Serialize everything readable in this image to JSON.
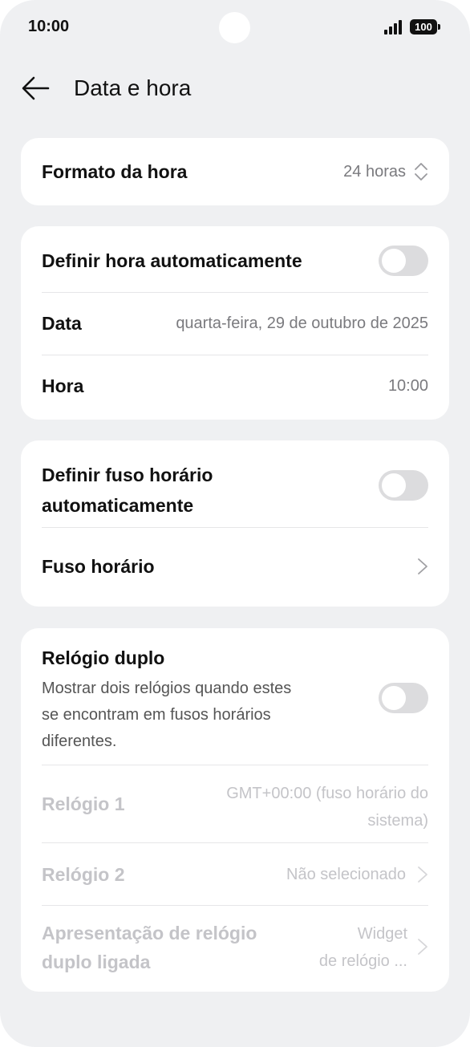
{
  "status_bar": {
    "time": "10:00",
    "battery": "100"
  },
  "header": {
    "title": "Data e hora"
  },
  "time_format": {
    "label": "Formato da hora",
    "value": "24 horas"
  },
  "auto_time": {
    "label": "Definir hora automaticamente",
    "enabled": false
  },
  "date": {
    "label": "Data",
    "value": "quarta-feira, 29 de outubro de 2025"
  },
  "time": {
    "label": "Hora",
    "value": "10:00"
  },
  "auto_timezone": {
    "label_line1": "Definir fuso horário",
    "label_line2": "automaticamente",
    "enabled": false
  },
  "timezone": {
    "label": "Fuso horário"
  },
  "dual_clock": {
    "label": "Relógio duplo",
    "desc_line1": "Mostrar dois relógios quando estes",
    "desc_line2": "se encontram em fusos horários",
    "desc_line3": "diferentes.",
    "enabled": false
  },
  "clock1": {
    "label": "Relógio 1",
    "value_line1": "GMT+00:00 (fuso horário do",
    "value_line2": "sistema)"
  },
  "clock2": {
    "label": "Relógio 2",
    "value": "Não selecionado"
  },
  "dual_display": {
    "label_line1": "Apresentação de relógio",
    "label_line2": "duplo ligada",
    "value_line1": "Widget",
    "value_line2": "de relógio ..."
  }
}
